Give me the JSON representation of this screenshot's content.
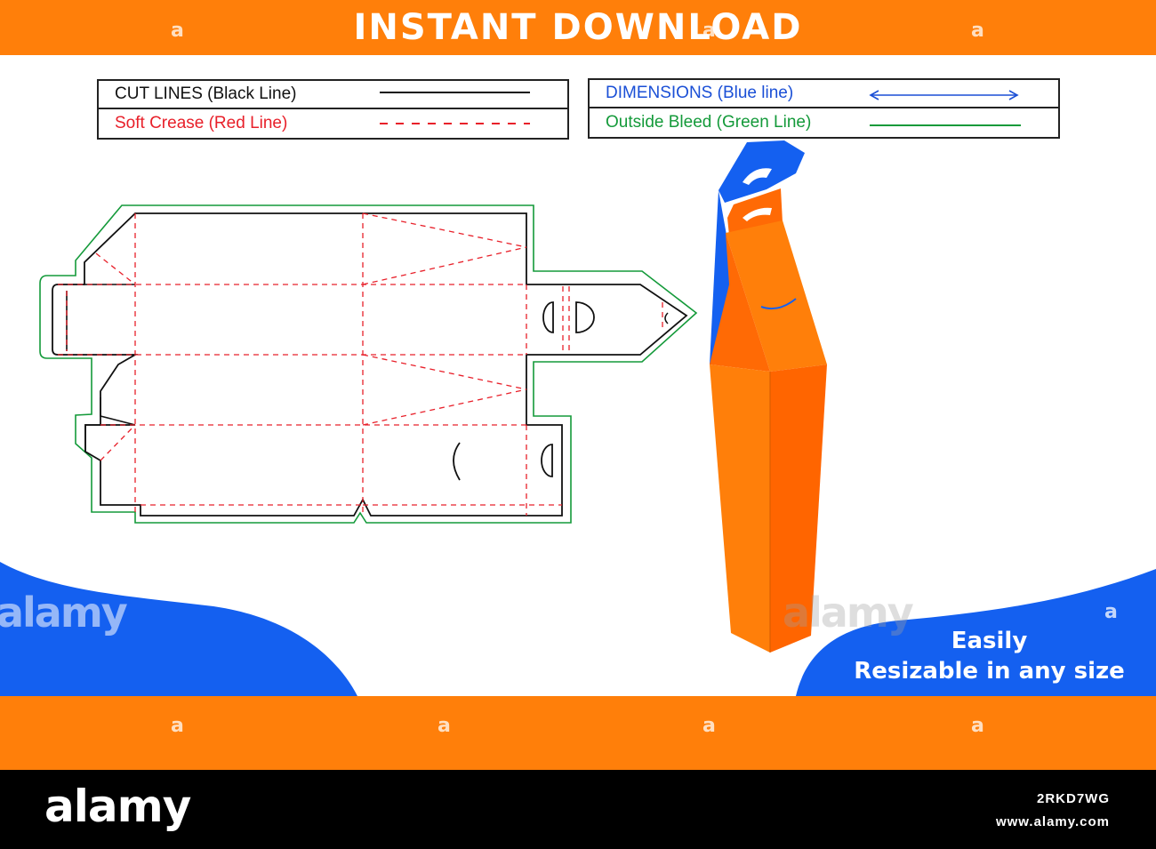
{
  "header": {
    "title": "INSTANT DOWNLOAD"
  },
  "legend": {
    "left": [
      {
        "label": "CUT LINES (Black Line)",
        "color": "#111111",
        "style": "solid"
      },
      {
        "label": "Soft Crease (Red Line)",
        "color": "#e8202a",
        "style": "dashed"
      }
    ],
    "right": [
      {
        "label": "DIMENSIONS (Blue line)",
        "color": "#1a4fd6",
        "style": "arrow"
      },
      {
        "label": "Outside Bleed (Green Line)",
        "color": "#149a3a",
        "style": "solid"
      }
    ]
  },
  "badge": {
    "line1": "Easily",
    "line2": "Resizable in any size"
  },
  "watermark": {
    "letter": "a",
    "word": "alamy"
  },
  "footer": {
    "brand": "alamy",
    "image_id": "2RKD7WG",
    "site": "www.alamy.com"
  },
  "colors": {
    "orange": "#ff7f0a",
    "blue": "#1460f0",
    "black_line": "#111111",
    "red_line": "#e8202a",
    "green_line": "#149a3a",
    "footer_bg": "#000000"
  },
  "icons": [
    "dieline-template",
    "box-mockup"
  ]
}
